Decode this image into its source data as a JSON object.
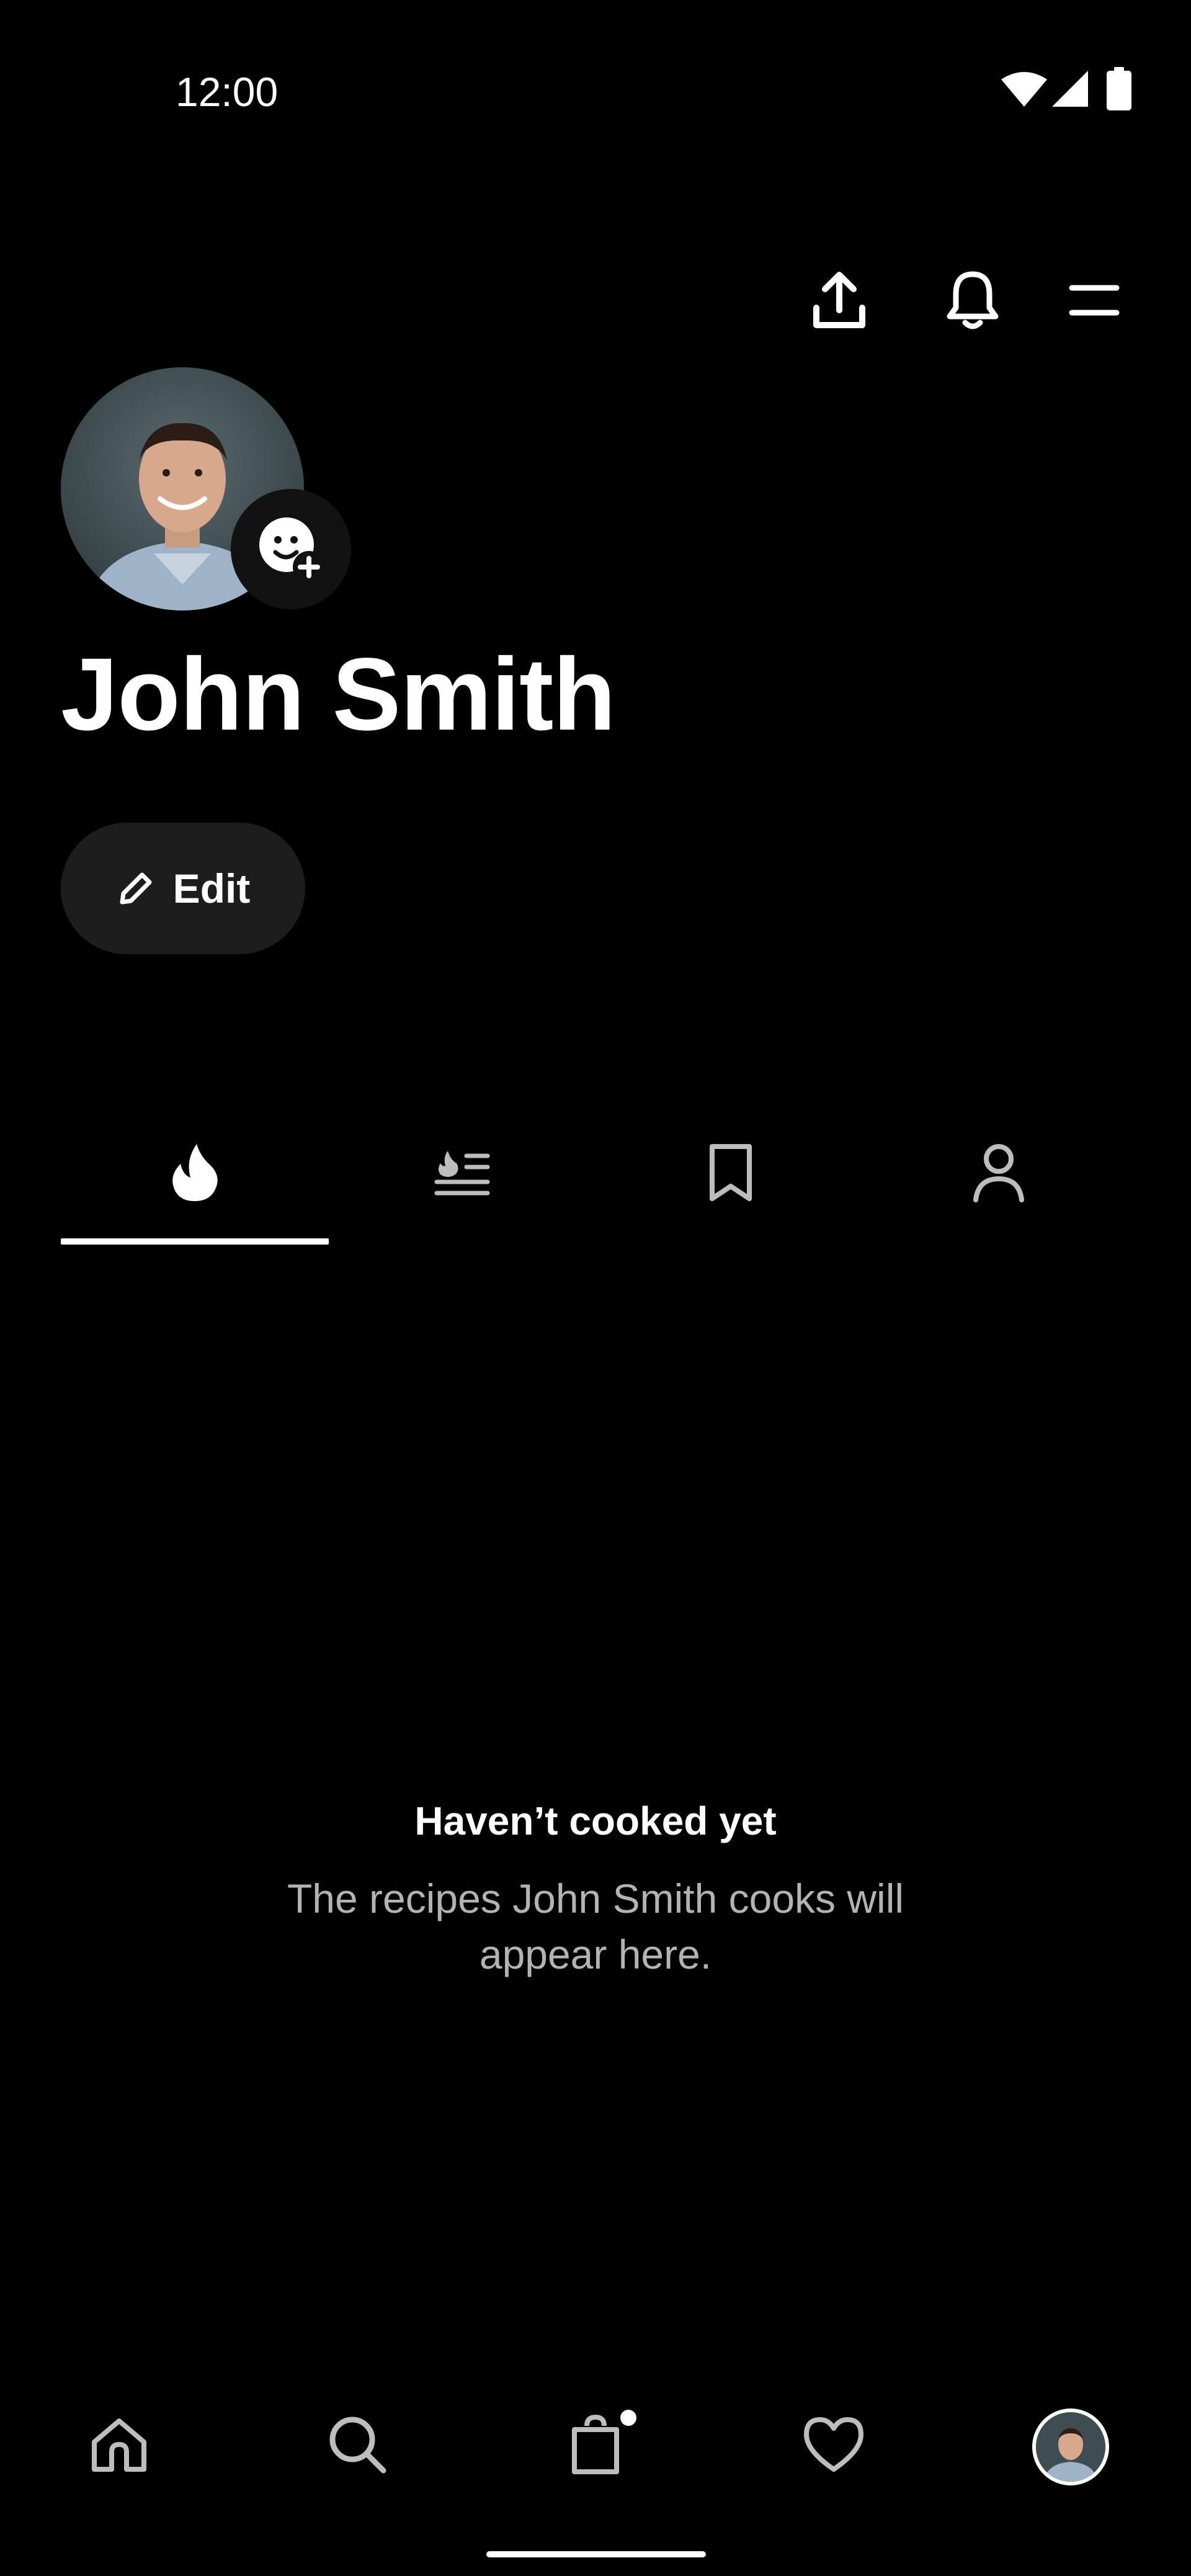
{
  "status_bar": {
    "time": "12:00",
    "icons": [
      "wifi-icon",
      "signal-icon",
      "battery-icon"
    ]
  },
  "header": {
    "actions": [
      "share-icon",
      "bell-icon",
      "menu-icon"
    ]
  },
  "profile": {
    "name": "John Smith",
    "edit_label": "Edit",
    "avatar_badge_icon": "add-avatar-icon"
  },
  "tabs": [
    {
      "icon": "flame-icon",
      "selected": true
    },
    {
      "icon": "cooked-list-icon",
      "selected": false
    },
    {
      "icon": "bookmark-icon",
      "selected": false
    },
    {
      "icon": "person-icon",
      "selected": false
    }
  ],
  "empty_state": {
    "title": "Haven’t cooked yet",
    "message": "The recipes John Smith cooks will appear here."
  },
  "bottom_nav": {
    "items": [
      "home-icon",
      "search-icon",
      "shopping-bag-icon",
      "heart-icon",
      "profile-avatar"
    ],
    "selected": "profile-avatar",
    "cart_has_items": true
  },
  "colors": {
    "background": "#000000",
    "text": "#FFFFFF",
    "muted_text": "#B3B3B3",
    "button_bg": "#1D1D1D"
  }
}
